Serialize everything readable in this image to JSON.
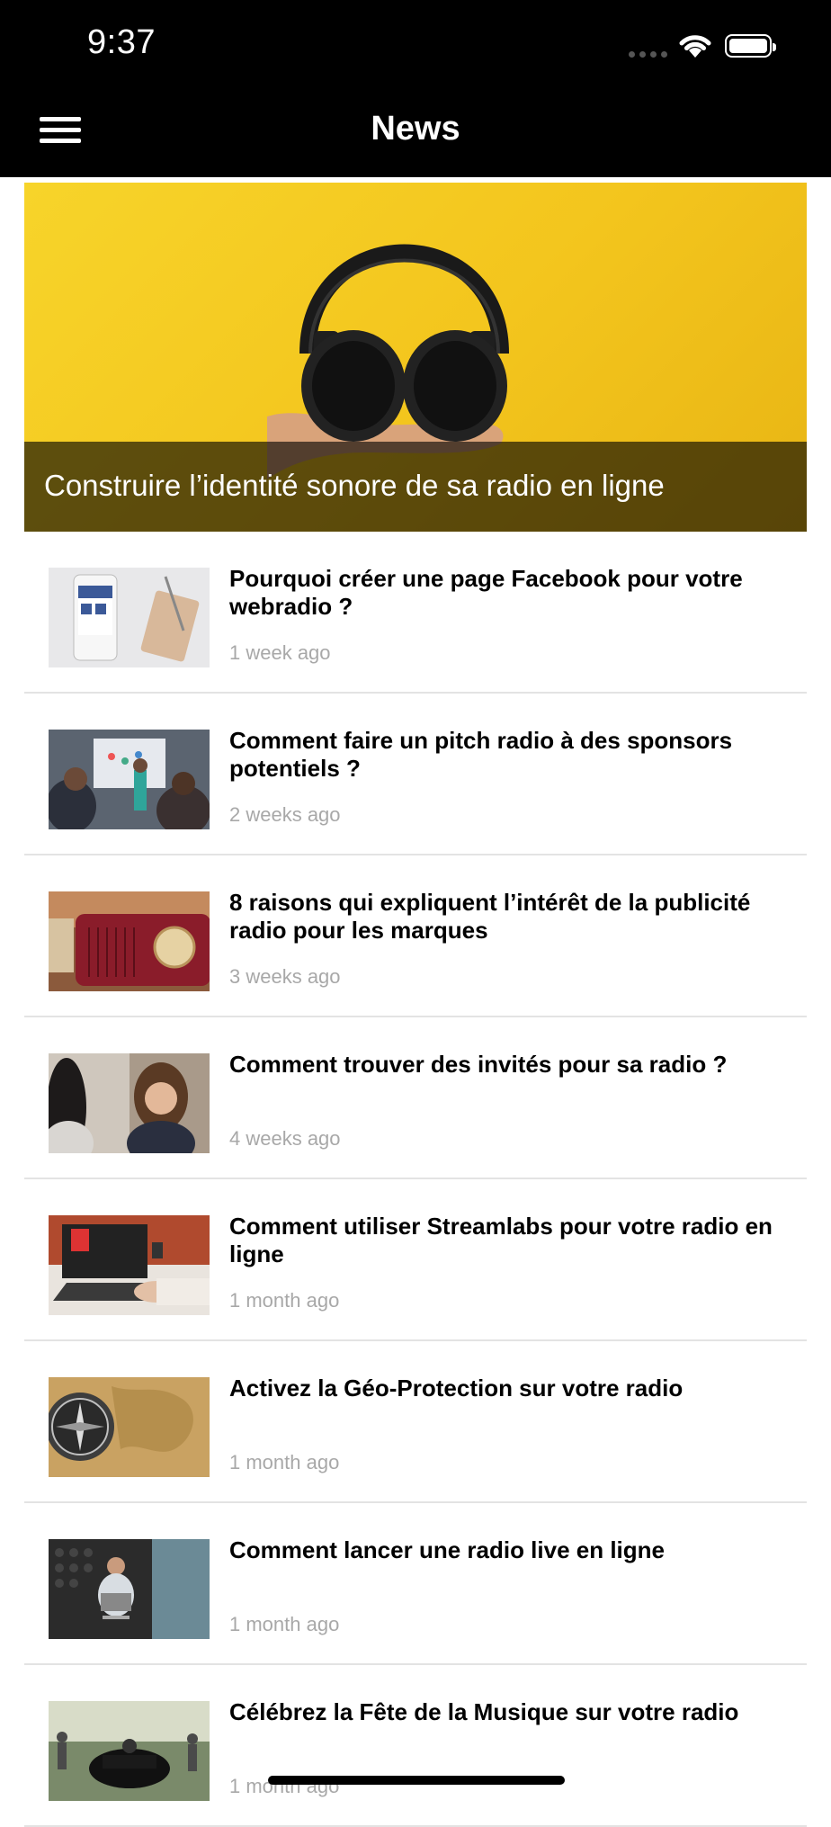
{
  "status_bar": {
    "time": "9:37"
  },
  "nav": {
    "title": "News"
  },
  "featured": {
    "title": "Construire l’identité sonore de sa radio en ligne",
    "accent_color": "#f5cb22"
  },
  "articles": [
    {
      "title": "Pourquoi créer une page Facebook pour votre webradio ?",
      "date": "1 week ago"
    },
    {
      "title": "Comment faire un pitch radio à des sponsors potentiels ?",
      "date": "2 weeks ago"
    },
    {
      "title": "8 raisons qui expliquent l’intérêt de la publicité radio pour les marques",
      "date": "3 weeks ago"
    },
    {
      "title": "Comment trouver des invités pour sa radio ?",
      "date": "4 weeks ago"
    },
    {
      "title": "Comment utiliser Streamlabs pour votre radio en ligne",
      "date": "1 month ago"
    },
    {
      "title": "Activez la Géo-Protection sur votre radio",
      "date": "1 month ago"
    },
    {
      "title": "Comment lancer une radio live en ligne",
      "date": "1 month ago"
    },
    {
      "title": "Célébrez la Fête de la Musique sur votre radio",
      "date": "1 month ago"
    }
  ]
}
